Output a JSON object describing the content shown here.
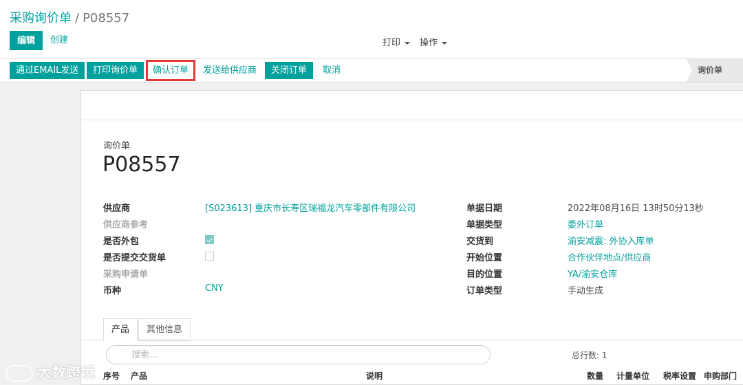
{
  "breadcrumb": {
    "parent": "采购询价单",
    "separator": "/",
    "current": "P08557"
  },
  "control": {
    "edit_label": "编辑",
    "create_label": "创建",
    "print_label": "打印",
    "action_label": "操作"
  },
  "statusbar": {
    "buttons": [
      "通过EMAIL发送",
      "打印询价单",
      "确认订单",
      "发送给供应商",
      "关闭订单",
      "取消"
    ],
    "stage": "询价单"
  },
  "form": {
    "doc_type": "询价单",
    "doc_number": "P08557",
    "left_fields": [
      {
        "label": "供应商",
        "value": "[S023613] 重庆市长寿区瑞福龙汽车零部件有限公司"
      },
      {
        "label": "供应商参考",
        "value": ""
      },
      {
        "label": "是否外包",
        "checked": true
      },
      {
        "label": "是否提交交货单",
        "checked": false
      },
      {
        "label": "采购申请单",
        "value": ""
      },
      {
        "label": "币种",
        "value": "CNY"
      }
    ],
    "right_fields": [
      {
        "label": "单据日期",
        "value": "2022年08月16日 13时50分13秒"
      },
      {
        "label": "单据类型",
        "value": "委外订单"
      },
      {
        "label": "交货到",
        "value": "渝安减震: 外协入库单"
      },
      {
        "label": "开始位置",
        "value": "合作伙伴地点/供应商"
      },
      {
        "label": "目的位置",
        "value": "YA/渝安仓库"
      },
      {
        "label": "订单类型",
        "value": "手动生成"
      }
    ]
  },
  "tabs": [
    "产品",
    "其他信息"
  ],
  "lines": {
    "search_placeholder": "搜索...",
    "row_count": "总行数: 1",
    "columns": [
      "序号",
      "产品",
      "说明",
      "数量",
      "计量单位",
      "税率设置",
      "申购部门"
    ]
  },
  "watermark": "大数跨境",
  "colors": {
    "accent": "#00a09d",
    "highlight_border": "#e53935"
  }
}
